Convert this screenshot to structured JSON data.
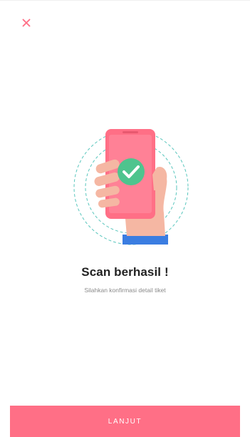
{
  "header": {
    "close_icon": "close-icon"
  },
  "illustration": {
    "icon": "phone-check-icon",
    "colors": {
      "phone": "#ff6f86",
      "check": "#4ec48e",
      "hand": "#f5b7a3",
      "sleeve": "#3b7de1",
      "rings": "#59c6bd"
    }
  },
  "main": {
    "title": "Scan berhasil !",
    "subtitle": "Silahkan konfirmasi detail tiket"
  },
  "footer": {
    "button_label": "LANJUT"
  },
  "theme": {
    "accent": "#ff6f86",
    "close": "#ff6f86"
  }
}
